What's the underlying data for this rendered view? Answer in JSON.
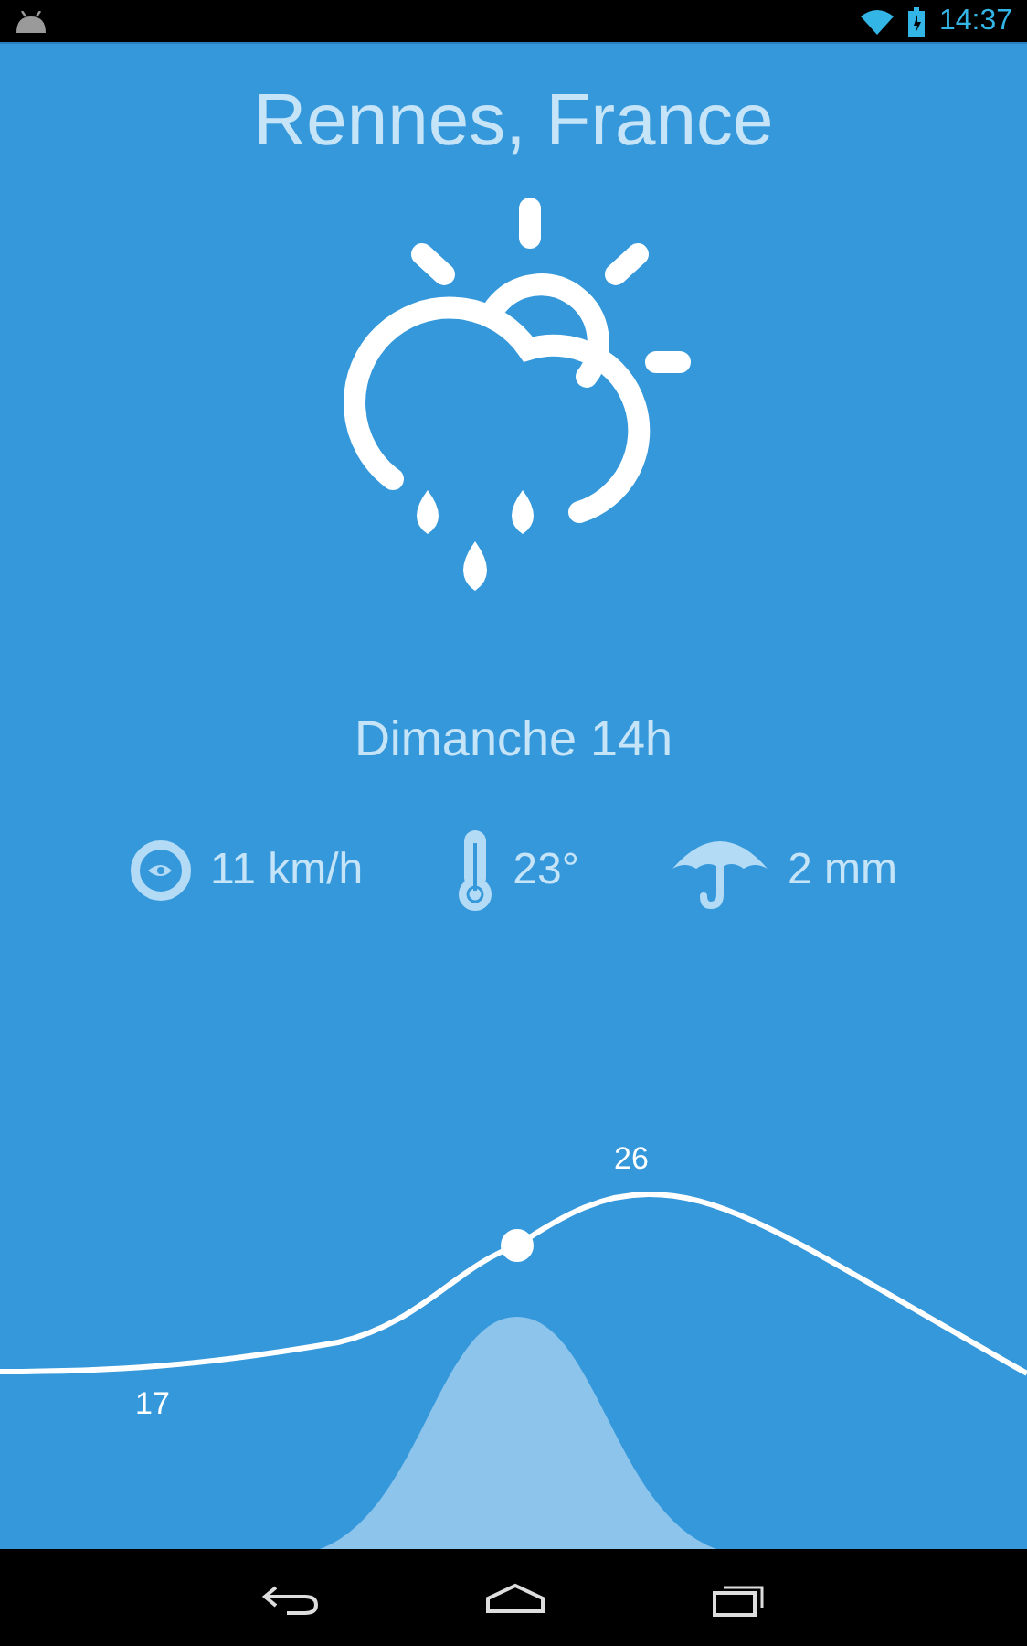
{
  "status_bar": {
    "time": "14:37"
  },
  "city": "Rennes, France",
  "time_label": "Dimanche 14h",
  "details": [
    {
      "kind": "wind",
      "value": "11 km/h"
    },
    {
      "kind": "temperature",
      "value": "23°"
    },
    {
      "kind": "rain",
      "value": "2 mm"
    }
  ],
  "chart": {
    "max_label": "26",
    "min_label": "17"
  }
}
